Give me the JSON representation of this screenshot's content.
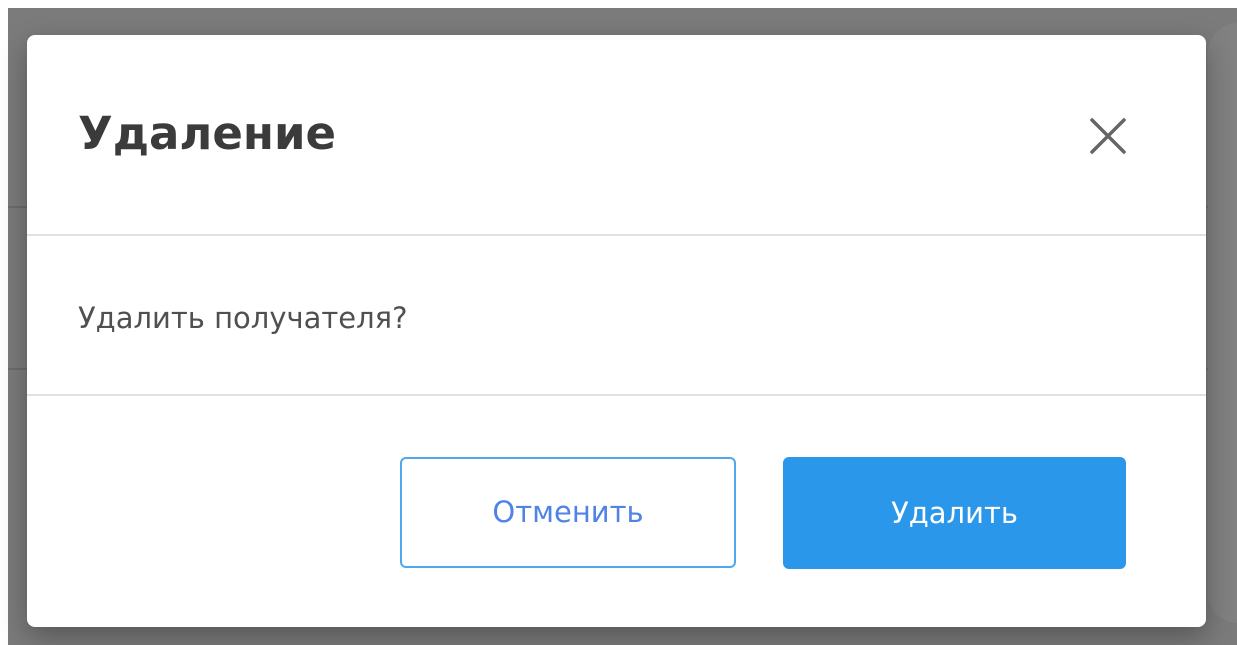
{
  "dialog": {
    "title": "Удаление",
    "message": "Удалить получателя?",
    "cancel_label": "Отменить",
    "delete_label": "Удалить",
    "close_icon": "close-icon"
  },
  "colors": {
    "primary": "#2a97ea",
    "outline": "#4fa7ee",
    "outline_text": "#4f83e6",
    "title_text": "#3b3b3b",
    "message_text": "#505050",
    "divider": "#dfe3e7",
    "overlay": "#7b7b7b"
  }
}
